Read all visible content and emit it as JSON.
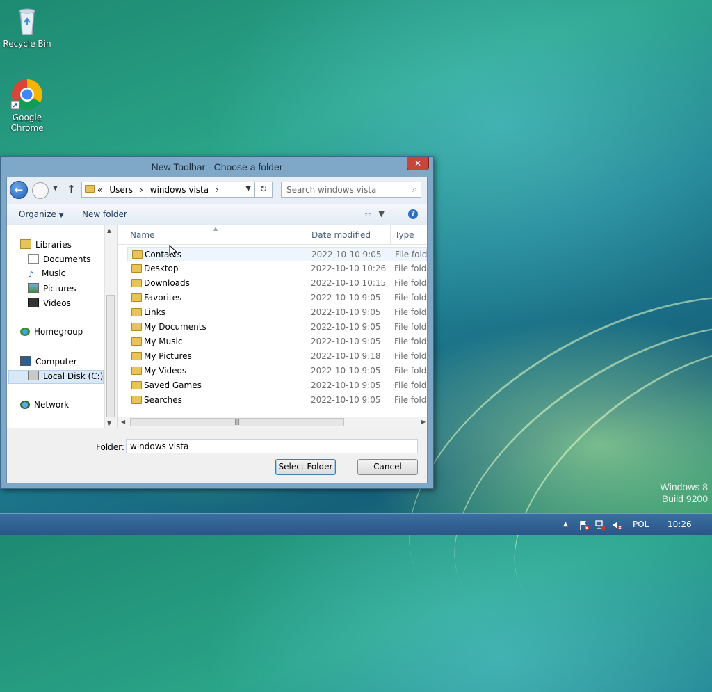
{
  "desktop": {
    "icons": [
      {
        "label": "Recycle Bin"
      },
      {
        "label": "Google Chrome"
      }
    ],
    "watermark": {
      "line1": "Windows 8",
      "line2": "Build 9200"
    }
  },
  "dialog": {
    "title": "New Toolbar - Choose a folder",
    "close_label": "✕",
    "address": {
      "overflow": "«",
      "crumbs": [
        "Users",
        "windows vista"
      ]
    },
    "search_placeholder": "Search windows vista",
    "commands": {
      "organize": "Organize",
      "new_folder": "New folder"
    },
    "nav_pane": {
      "libraries": "Libraries",
      "library_items": [
        "Documents",
        "Music",
        "Pictures",
        "Videos"
      ],
      "homegroup": "Homegroup",
      "computer": "Computer",
      "computer_items": [
        "Local Disk (C:)"
      ],
      "network": "Network"
    },
    "columns": {
      "name": "Name",
      "date": "Date modified",
      "type": "Type"
    },
    "files": [
      {
        "name": "Contacts",
        "date": "2022-10-10 9:05",
        "type": "File folder"
      },
      {
        "name": "Desktop",
        "date": "2022-10-10 10:26",
        "type": "File folder"
      },
      {
        "name": "Downloads",
        "date": "2022-10-10 10:15",
        "type": "File folder"
      },
      {
        "name": "Favorites",
        "date": "2022-10-10 9:05",
        "type": "File folder"
      },
      {
        "name": "Links",
        "date": "2022-10-10 9:05",
        "type": "File folder"
      },
      {
        "name": "My Documents",
        "date": "2022-10-10 9:05",
        "type": "File folder"
      },
      {
        "name": "My Music",
        "date": "2022-10-10 9:05",
        "type": "File folder"
      },
      {
        "name": "My Pictures",
        "date": "2022-10-10 9:18",
        "type": "File folder"
      },
      {
        "name": "My Videos",
        "date": "2022-10-10 9:05",
        "type": "File folder"
      },
      {
        "name": "Saved Games",
        "date": "2022-10-10 9:05",
        "type": "File folder"
      },
      {
        "name": "Searches",
        "date": "2022-10-10 9:05",
        "type": "File folder"
      }
    ],
    "folder_label": "Folder:",
    "folder_value": "windows vista",
    "select_button": "Select Folder",
    "cancel_button": "Cancel"
  },
  "taskbar": {
    "language": "POL",
    "time": "10:26"
  }
}
